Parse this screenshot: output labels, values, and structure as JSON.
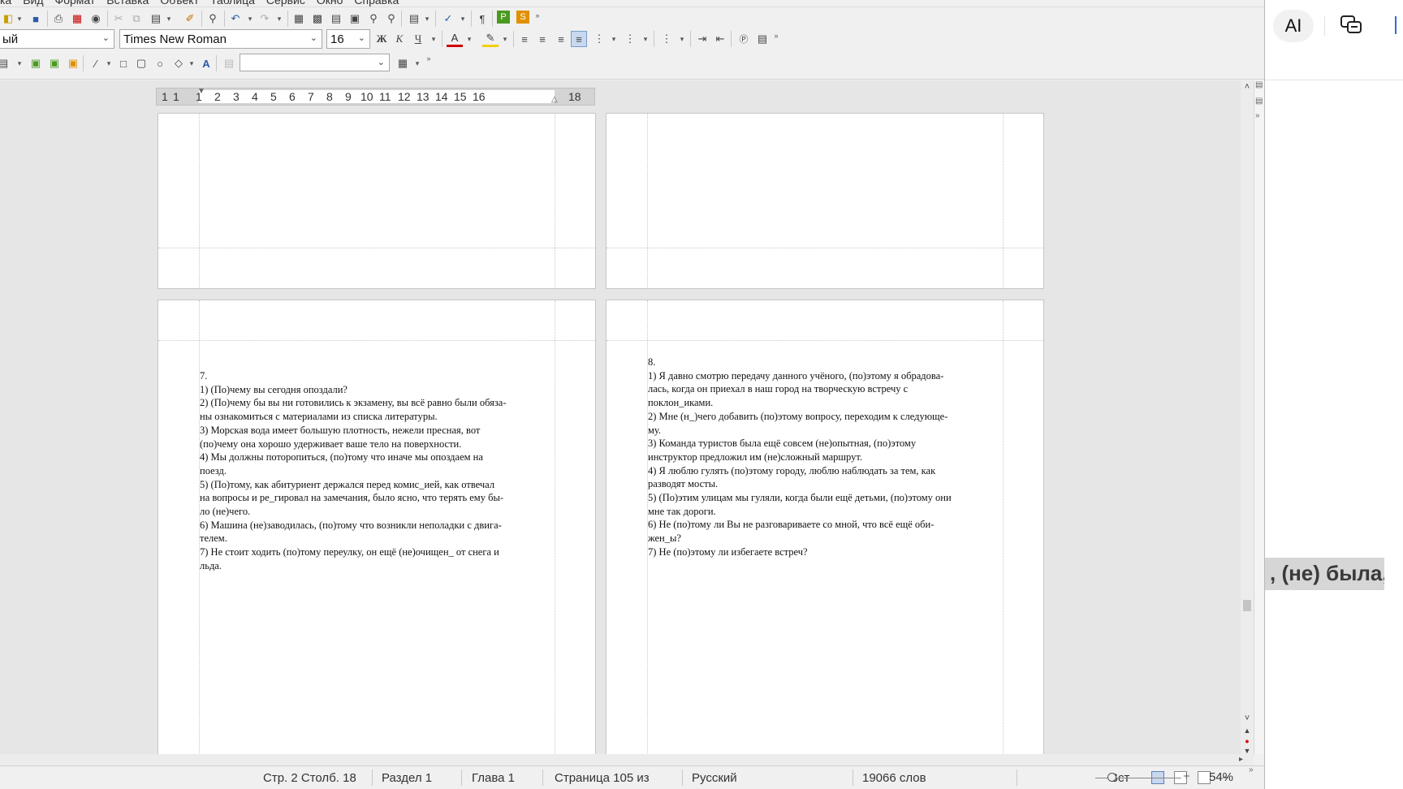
{
  "menubar": {
    "items": [
      "ка",
      "Вид",
      "Формат",
      "Вставка",
      "Объект",
      "Таблица",
      "Сервис",
      "Окно",
      "Справка"
    ]
  },
  "toolbar_format": {
    "paragraph_style": "ый",
    "font_name": "Times New Roman",
    "font_size": "16",
    "bold_label": "Ж",
    "italic_label": "К",
    "underline_label": "Ч"
  },
  "ruler": {
    "numbers": [
      "1",
      "1",
      "1",
      "2",
      "3",
      "4",
      "5",
      "6",
      "7",
      "8",
      "9",
      "10",
      "11",
      "12",
      "13",
      "14",
      "15",
      "16",
      "18"
    ]
  },
  "pages": {
    "left_bottom": {
      "lines": [
        "7.",
        "1) (По)чему вы сегодня опоздали?",
        "2) (По)чему бы вы ни готовились к экзамену, вы всё равно были обяза-",
        "ны ознакомиться с материалами из списка литературы.",
        "3) Морская вода имеет большую плотность, нежели пресная, вот",
        "(по)чему она хорошо удерживает ваше тело на поверхности.",
        "4) Мы должны поторопиться, (по)тому что иначе мы опоздаем на",
        "поезд.",
        "5) (По)тому, как абитуриент держался перед комис_ией, как отвечал",
        "на вопросы и ре_гировал на замечания, было ясно, что терять ему бы-",
        "ло (не)чего.",
        "6) Машина (не)заводилась, (по)тому что возникли неполадки с двига-",
        "телем.",
        "7) Не стоит ходить (по)тому переулку, он ещё (не)очищен_ от снега и",
        "льда."
      ]
    },
    "right_bottom": {
      "lines": [
        "8.",
        "1) Я давно смотрю передачу данного учёного, (по)этому я обрадова-",
        "лась, когда он приехал в наш город на творческую встречу с",
        "поклон_иками.",
        "2) Мне (н_)чего добавить (по)этому вопросу, переходим к следующе-",
        "му.",
        "3) Команда туристов была ещё совсем (не)опытная, (по)этому",
        "инструктор предложил им (не)сложный маршрут.",
        "4) Я люблю гулять (по)этому городу, люблю наблюдать за тем, как",
        "разводят мосты.",
        "5) (По)этим улицам мы гуляли, когда были ещё детьми, (по)этому они",
        "мне так дороги.",
        "6) Не (по)тому ли Вы не разговариваете со мной, что всё ещё оби-",
        "жен_ы?",
        "7) Не (по)этому ли избегаете встреч?"
      ]
    }
  },
  "statusbar": {
    "position": "Стр. 2 Столб. 18",
    "section": "Раздел 1",
    "chapter": "Глава 1",
    "page": "Страница 105 из",
    "language": "Русский",
    "word_count": "19066 слов",
    "insert_mode": "Вст",
    "zoom": "54%"
  },
  "right_panel": {
    "ai_label": "AI",
    "snippet_text": ", (не) была,"
  },
  "colors": {
    "accent": "#2f6dd1",
    "font_color_red": "#d00000",
    "highlight_yellow": "#f5d000",
    "active_button": "#c8d8ee"
  }
}
